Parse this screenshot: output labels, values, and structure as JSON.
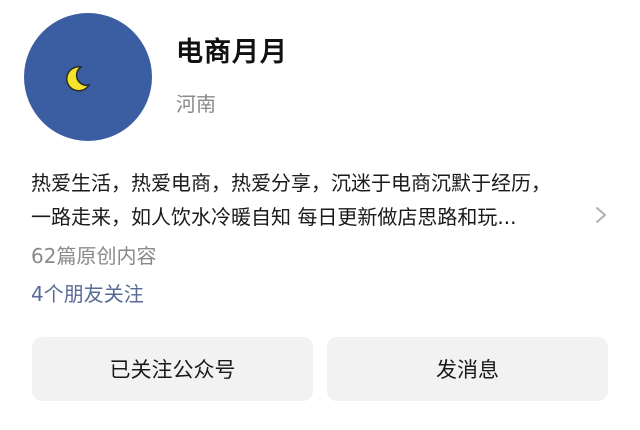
{
  "profile": {
    "name": "电商月月",
    "location": "河南",
    "avatar_icon": "crescent-moon-icon",
    "avatar_color": "#3b5ea3",
    "moon_color": "#f5e22a"
  },
  "bio": {
    "line1": "热爱生活，热爱电商，热爱分享，沉迷于电商沉默于经历，",
    "line2": "一路走来，如人饮水冷暖自知 每日更新做店思路和玩..."
  },
  "stats": {
    "articles": "62篇原创内容",
    "friends_following": "4个朋友关注"
  },
  "actions": {
    "followed_label": "已关注公众号",
    "message_label": "发消息"
  },
  "icons": {
    "expand": "chevron-right-icon"
  }
}
